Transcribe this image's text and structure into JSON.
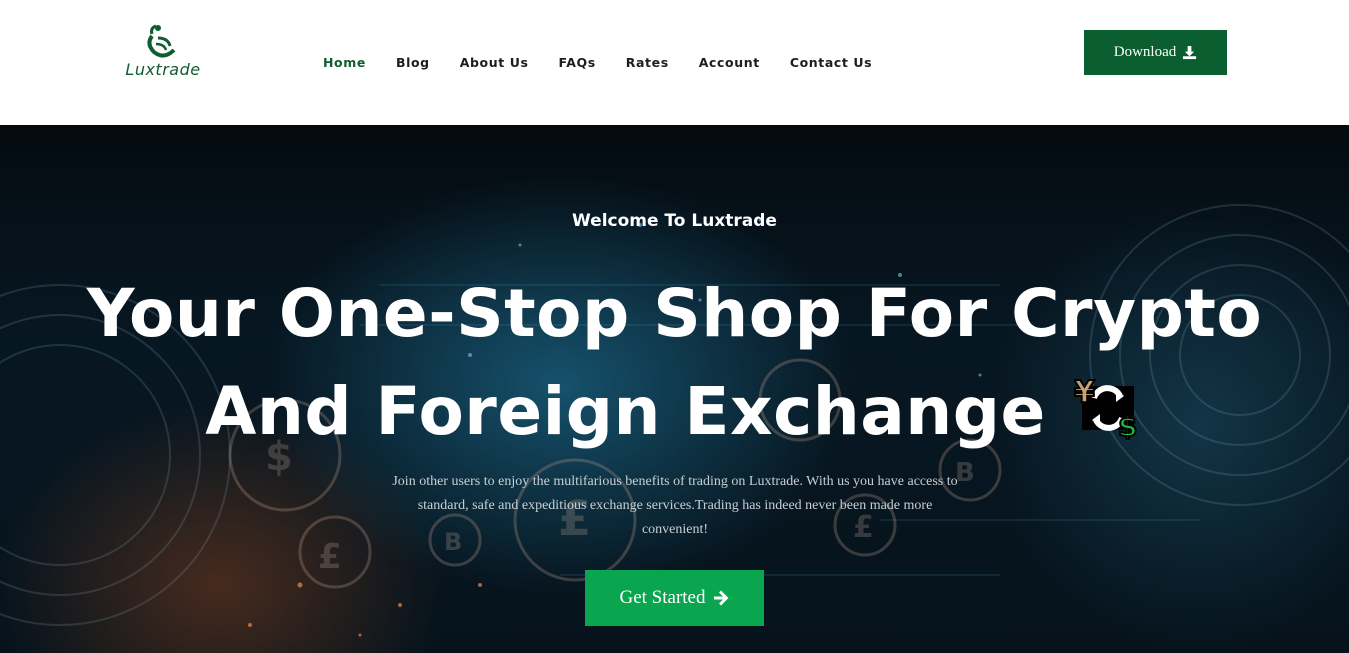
{
  "brand": {
    "name": "Luxtrade",
    "color": "#0f5d30"
  },
  "nav": {
    "items": [
      {
        "label": "Home",
        "active": true
      },
      {
        "label": "Blog",
        "active": false
      },
      {
        "label": "About Us",
        "active": false
      },
      {
        "label": "FAQs",
        "active": false
      },
      {
        "label": "Rates",
        "active": false
      },
      {
        "label": "Account",
        "active": false
      },
      {
        "label": "Contact Us",
        "active": false
      }
    ]
  },
  "header": {
    "download_label": "Download",
    "download_icon": "download-icon",
    "download_color": "#0b5e2f"
  },
  "hero": {
    "welcome": "Welcome To Luxtrade",
    "headline_line1": "Your One-Stop Shop For Crypto",
    "headline_line2": "And Foreign Exchange",
    "headline_icon": "currency-exchange-icon",
    "subtitle": "Join other users to enjoy the multifarious benefits of trading on Luxtrade. With us you have access to standard, safe and expeditious exchange services.Trading has indeed never been made more convenient!",
    "cta_label": "Get Started",
    "cta_icon": "arrow-right-icon",
    "cta_color": "#0aa64f"
  }
}
